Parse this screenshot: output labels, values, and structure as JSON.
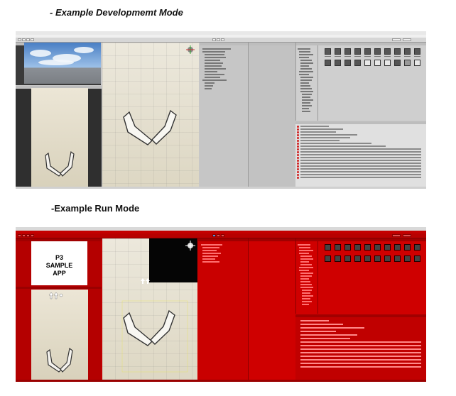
{
  "captions": {
    "dev_mode": "- Example Developmemt Mode",
    "run_mode": "-Example Run Mode"
  },
  "run_overlay": {
    "line1": "P3",
    "line2": "SAMPLE",
    "line3": "APP"
  },
  "colors": {
    "dev_editor_bg": "#c8c8c8",
    "run_mode_tint": "#d40000",
    "console_error": "#d02020"
  },
  "icons": [
    "flipper-left-icon",
    "flipper-right-icon",
    "scene-gizmo-icon",
    "arrow-up-icon",
    "asset-thumbnail-icon",
    "error-icon"
  ]
}
